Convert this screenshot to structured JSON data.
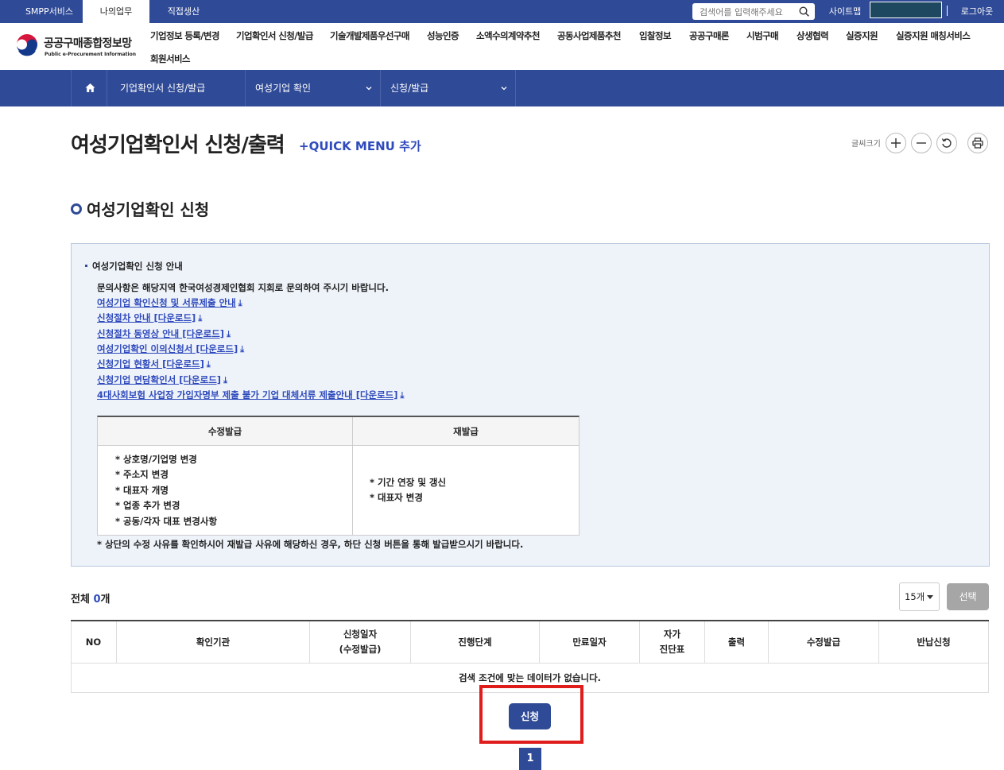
{
  "topbar": {
    "tabs": [
      "SMPP서비스",
      "나의업무",
      "직접생산"
    ],
    "search_placeholder": "검색어를 입력해주세요",
    "sitemap": "사이트맵",
    "logout": "로그아웃"
  },
  "logo": {
    "title": "공공구매종합정보망",
    "subtitle": "Public e-Procurement Information"
  },
  "gnb": [
    "기업정보 등록/변경",
    "기업확인서 신청/발급",
    "기술개발제품우선구매",
    "성능인증",
    "소액수의계약추천",
    "공동사업제품추천",
    "입찰정보",
    "공공구매론",
    "시범구매",
    "상생협력",
    "실증지원",
    "실증지원 매칭서비스",
    "회원서비스"
  ],
  "navbar": {
    "seg1": "기업확인서 신청/발급",
    "seg2": "여성기업 확인",
    "seg3": "신청/발급"
  },
  "page": {
    "title": "여성기업확인서 신청/출력",
    "quick_menu": "+QUICK MENU 추가",
    "font_size_label": "글씨크기",
    "section_title": "여성기업확인 신청"
  },
  "info": {
    "heading": "여성기업확인 신청 안내",
    "desc": "문의사항은 해당지역 한국여성경제인협회 지회로 문의하여 주시기 바랍니다.",
    "links": [
      "여성기업 확인신청 및 서류제출 안내",
      "신청절차 안내 [다운로드]",
      "신청절차 동영상 안내 [다운로드]",
      "여성기업확인 이의신청서 [다운로드]",
      "신청기업 현황서 [다운로드]",
      "신청기업 면담확인서 [다운로드]",
      "4대사회보험 사업장 가입자명부 제출 불가 기업 대체서류 제출안내 [다운로드]"
    ],
    "table": {
      "headers": [
        "수정발급",
        "재발급"
      ],
      "col1": [
        "* 상호명/기업명 변경",
        "* 주소지 변경",
        "* 대표자 개명",
        "* 업종 추가 변경",
        "* 공동/각자 대표 변경사항"
      ],
      "col2": [
        "* 기간 연장 및 갱신",
        "* 대표자 변경"
      ]
    },
    "note": "* 상단의 수정 사유를 확인하시어 재발급 사유에 해당하신 경우, 하단 신청 버튼을 통해 발급받으시기 바랍니다."
  },
  "list": {
    "total_prefix": "전체 ",
    "total_count": "0",
    "total_suffix": "개",
    "page_size": "15개",
    "select_button": "선택",
    "columns": [
      "NO",
      "확인기관",
      "신청일자\n(수정발급)",
      "진행단계",
      "만료일자",
      "자가\n진단표",
      "출력",
      "수정발급",
      "반납신청"
    ],
    "empty_message": "검색 조건에 맞는 데이터가 없습니다.",
    "apply_button": "신청",
    "page": "1"
  }
}
